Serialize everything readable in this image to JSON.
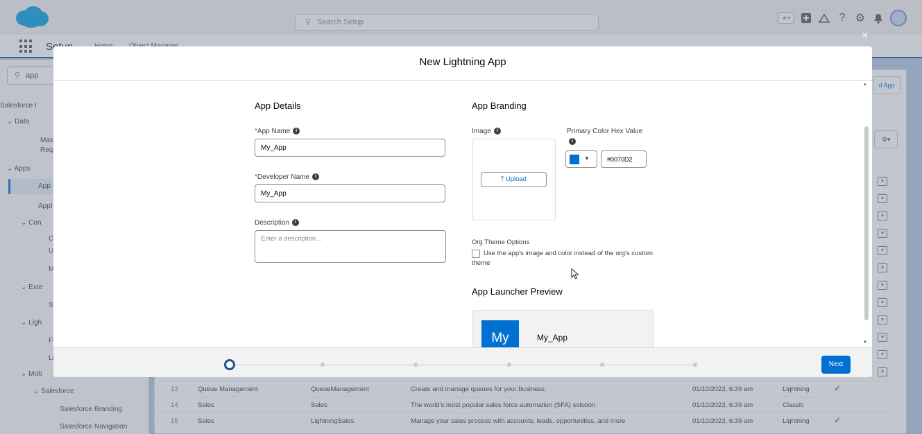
{
  "header": {
    "search_placeholder": "Search Setup",
    "icons": [
      "favorites-icon",
      "add-icon",
      "trailhead-icon",
      "help-icon",
      "setup-gear-icon",
      "notification-bell-icon",
      "avatar"
    ]
  },
  "nav": {
    "title": "Setup",
    "tabs": [
      "Home",
      "Object Manager"
    ]
  },
  "sidebar": {
    "search_value": "app",
    "items": [
      "Salesforce I",
      "Data",
      "Mas",
      "Req",
      "Apps",
      "App",
      "AppI",
      "Con",
      "C",
      "U",
      "M",
      "Exte",
      "S",
      "Ligh",
      "Fl",
      "Li",
      "Mob",
      "Salesforce",
      "Salesforce Branding",
      "Salesforce Navigation"
    ]
  },
  "background_table": {
    "rows": [
      {
        "num": "13",
        "label": "Queue Management",
        "dev_name": "QueueManagement",
        "description": "Create and manage queues for your business.",
        "modified": "01/10/2023, 6:39 am",
        "type": "Lightning",
        "check": "✓"
      },
      {
        "num": "14",
        "label": "Sales",
        "dev_name": "Sales",
        "description": "The world's most popular sales force automation (SFA) solution",
        "modified": "01/10/2023, 6:39 am",
        "type": "Classic",
        "check": ""
      },
      {
        "num": "15",
        "label": "Sales",
        "dev_name": "LightningSales",
        "description": "Manage your sales process with accounts, leads, opportunities, and more",
        "modified": "01/10/2023, 6:39 am",
        "type": "Lightning",
        "check": "✓"
      }
    ],
    "new_app_button": "d App"
  },
  "modal": {
    "title": "New Lightning App",
    "close": "×",
    "app_details": {
      "title": "App Details",
      "app_name_label": "App Name",
      "app_name_value": "My_App",
      "developer_name_label": "Developer Name",
      "developer_name_value": "My_App",
      "description_label": "Description",
      "description_placeholder": "Enter a description...",
      "required_mark": "*"
    },
    "app_branding": {
      "title": "App Branding",
      "image_label": "Image",
      "upload_label": "Upload",
      "primary_color_label": "Primary Color Hex Value",
      "primary_color_value": "#0070D2",
      "org_theme_label": "Org Theme Options",
      "org_theme_checkbox_text": "Use the app's image and color instead of the org's custom theme",
      "org_theme_checked": false
    },
    "launcher_preview": {
      "title": "App Launcher Preview",
      "tile_text": "My",
      "app_name": "My_App"
    },
    "progress": {
      "total_steps": 6,
      "current_step": 1
    },
    "next_label": "Next"
  },
  "colors": {
    "brand_blue": "#0070d2",
    "nav_underline": "#1b5297",
    "required_red": "#c23934"
  }
}
